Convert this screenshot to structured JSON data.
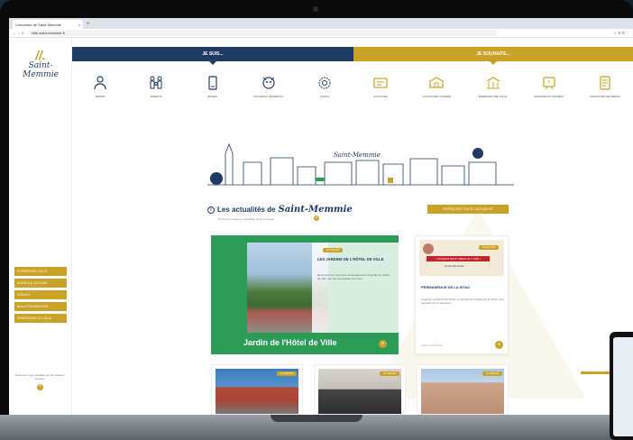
{
  "browser": {
    "tab_title": "Commune de Saint-Memmie",
    "tab_close": "×",
    "tab_new": "+",
    "nav_buttons": "←  →  C",
    "url": "ville-saint-memmie.fr",
    "right_icons": "☆  ✕  ⊡  ⋮"
  },
  "sidebar": {
    "logo_mark": "//.",
    "logo_text": "Saint-Memmie",
    "buttons": [
      "ENTREPRISE / ELUS",
      "AGENDA & CULTURE",
      "CONSEIL",
      "BULLETIN MUNICIPAL",
      "DEMARCHES EN LIGNE"
    ],
    "note": "Retrouvez notre actualité sur les réseaux sociaux",
    "plus": "+"
  },
  "nav": {
    "left": "JE SUIS...",
    "right": "JE SOUHAITE..."
  },
  "icons_row": [
    {
      "label": "SENIOR",
      "icon": "person-icon"
    },
    {
      "label": "PARENTS",
      "icon": "family-icon"
    },
    {
      "label": "JEUNES",
      "icon": "youth-icon"
    },
    {
      "label": "NOUVEAUX RESIDENTS",
      "icon": "new-resident-icon"
    },
    {
      "label": "ACTIFS",
      "icon": "worker-icon"
    },
    {
      "label": "POSTULER",
      "icon": "apply-icon"
    },
    {
      "label": "CONTACTER LA MAIRIE",
      "icon": "contact-icon"
    },
    {
      "label": "RESERVER UNE SALLE",
      "icon": "room-icon"
    },
    {
      "label": "SIGNALER UN INCIDENT",
      "icon": "incident-icon"
    },
    {
      "label": "CONSULTER LES MENUS",
      "icon": "menu-icon"
    }
  ],
  "news": {
    "title_prefix": "Les actualités de",
    "title_town": "Saint-Memmie",
    "subtitle": "Retrouvez toutes les actualités de la commune",
    "all_button": "RETROUVEZ TOUTE L'ACTUALITÉ",
    "plus": "+"
  },
  "card_main": {
    "badge": "ACTUALITÉ",
    "title": "LES JARDINS DE L'HÔTEL DE VILLE",
    "text": "Découvrez les nouveaux aménagements du jardin de l'Hôtel de Ville, lieu de promenade pour tous.",
    "caption": "Jardin de l'Hôtel de Ville",
    "plus": "+"
  },
  "card_side": {
    "badge": "ACTUALITÉ",
    "poster_band": "L'AGENCE SITAC SERA LE 7 JUIN !",
    "poster_sub": "Saint-Memmie",
    "title": "PERMANENCE DE LA SITAC",
    "text": "L'agence mobile de la SITAC se tiendra sur la place de la mairie pour répondre à vos questions.",
    "foot": "Publié le 01/06/2023",
    "plus": "+"
  },
  "thumbs": [
    {
      "badge": "ACTUALITÉ"
    },
    {
      "badge": "ACTUALITÉ"
    },
    {
      "badge": "ACTUALITÉ"
    }
  ],
  "colors": {
    "navy": "#1f3b63",
    "gold": "#c9a227",
    "green": "#2d9b58"
  }
}
